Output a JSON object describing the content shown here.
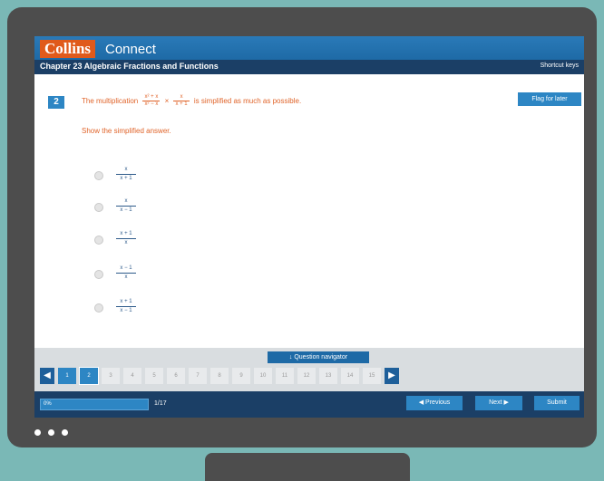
{
  "header": {
    "brand": "Collins",
    "product": "Connect",
    "chapter_title": "Chapter 23 Algebraic Fractions and Functions",
    "shortcut_keys": "Shortcut keys"
  },
  "question": {
    "number": "2",
    "prefix": "The multiplication",
    "frac1_num": "x² + x",
    "frac1_den": "x² − x",
    "times": "×",
    "frac2_num": "x",
    "frac2_den": "x + 1",
    "suffix": "is simplified as much as possible.",
    "instruction": "Show the simplified answer.",
    "flag_label": "Flag for later"
  },
  "options": [
    {
      "num": "x",
      "den": "x + 1"
    },
    {
      "num": "x",
      "den": "x − 1"
    },
    {
      "num": "x + 1",
      "den": "x"
    },
    {
      "num": "x − 1",
      "den": "x"
    },
    {
      "num": "x + 1",
      "den": "x − 1"
    }
  ],
  "navigation": {
    "question_nav_label": "↓ Question navigator",
    "pages": [
      "1",
      "2",
      "3",
      "4",
      "5",
      "6",
      "7",
      "8",
      "9",
      "10",
      "11",
      "12",
      "13",
      "14",
      "15"
    ],
    "current_page": 2,
    "prev_arrow": "◀",
    "next_arrow": "▶"
  },
  "footer": {
    "progress_text": "0%",
    "progress_fraction": 0.0,
    "count": "1/17",
    "previous_label": "◀  Previous",
    "next_label": "Next  ▶",
    "submit_label": "Submit"
  }
}
